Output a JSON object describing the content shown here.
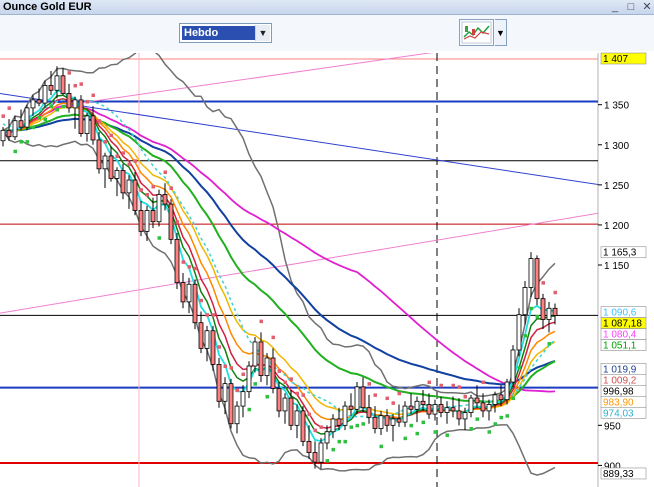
{
  "window": {
    "title": "Ounce Gold EUR"
  },
  "toolbar": {
    "period": "Hebdo"
  },
  "chart_data": {
    "type": "candlestick",
    "ylim": [
      890,
      1415
    ],
    "y_ticks": [
      "1 350",
      "1 300",
      "1 250",
      "1 200",
      "1 150",
      "950",
      "900"
    ],
    "price_tags": [
      {
        "label": "1 407",
        "value": 1407,
        "bg": "#ffff00",
        "fg": "#000000"
      },
      {
        "label": "1 165,3",
        "value": 1165.3,
        "bg": "#ffffff",
        "fg": "#000000"
      },
      {
        "label": "1 090,6",
        "value": 1090.6,
        "bg": "#ffffff",
        "fg": "#40c0ff"
      },
      {
        "label": "1 087,18",
        "value": 1087.18,
        "bg": "#ffff00",
        "fg": "#000000"
      },
      {
        "label": "1 080,4",
        "value": 1080.4,
        "bg": "#ffffff",
        "fg": "#ff40ff"
      },
      {
        "label": "1 051,1",
        "value": 1051.1,
        "bg": "#ffffff",
        "fg": "#00a000"
      },
      {
        "label": "1 019,9",
        "value": 1019.9,
        "bg": "#ffffff",
        "fg": "#204090"
      },
      {
        "label": "1 009,2",
        "value": 1009.2,
        "bg": "#ffffff",
        "fg": "#d05050"
      },
      {
        "label": "996,98",
        "value": 996.98,
        "bg": "#ffffff",
        "fg": "#000000"
      },
      {
        "label": "983,90",
        "value": 983.9,
        "bg": "#ffffff",
        "fg": "#ff9900"
      },
      {
        "label": "974,03",
        "value": 974.03,
        "bg": "#ffffff",
        "fg": "#30b0d0"
      },
      {
        "label": "889,33",
        "value": 889.33,
        "bg": "#ffffff",
        "fg": "#000000"
      }
    ],
    "horizontal_levels": [
      {
        "value": 1407,
        "color": "#ff8080"
      },
      {
        "value": 1354,
        "color": "#1a3cc0"
      },
      {
        "value": 1280,
        "color": "#000000"
      },
      {
        "value": 1201,
        "color": "#c00000"
      },
      {
        "value": 1087.18,
        "color": "#000000"
      },
      {
        "value": 997,
        "color": "#1a3cc0"
      },
      {
        "value": 903,
        "color": "#e00000"
      }
    ],
    "trend_lines": [
      {
        "x1": 0,
        "y1": 1364,
        "x2": 600,
        "y2": 1250,
        "color": "#3040d0"
      },
      {
        "x1": 0,
        "y1": 1090,
        "x2": 600,
        "y2": 1215,
        "color": "#f080d0"
      },
      {
        "x1": 40,
        "y1": 1345,
        "x2": 600,
        "y2": 1445,
        "color": "#f080d0"
      }
    ],
    "candles": [
      [
        1305,
        1322,
        1298,
        1318
      ],
      [
        1318,
        1332,
        1305,
        1310
      ],
      [
        1310,
        1336,
        1306,
        1330
      ],
      [
        1330,
        1344,
        1318,
        1322
      ],
      [
        1322,
        1350,
        1318,
        1346
      ],
      [
        1346,
        1362,
        1336,
        1356
      ],
      [
        1356,
        1370,
        1348,
        1352
      ],
      [
        1352,
        1380,
        1346,
        1374
      ],
      [
        1374,
        1392,
        1362,
        1368
      ],
      [
        1368,
        1398,
        1358,
        1386
      ],
      [
        1386,
        1396,
        1362,
        1364
      ],
      [
        1364,
        1376,
        1340,
        1346
      ],
      [
        1346,
        1360,
        1320,
        1356
      ],
      [
        1356,
        1362,
        1310,
        1314
      ],
      [
        1314,
        1340,
        1304,
        1336
      ],
      [
        1336,
        1348,
        1300,
        1306
      ],
      [
        1306,
        1316,
        1264,
        1270
      ],
      [
        1270,
        1290,
        1246,
        1286
      ],
      [
        1286,
        1298,
        1254,
        1258
      ],
      [
        1258,
        1272,
        1236,
        1268
      ],
      [
        1268,
        1276,
        1232,
        1240
      ],
      [
        1240,
        1262,
        1220,
        1256
      ],
      [
        1256,
        1266,
        1212,
        1218
      ],
      [
        1218,
        1230,
        1186,
        1192
      ],
      [
        1192,
        1224,
        1180,
        1218
      ],
      [
        1218,
        1234,
        1196,
        1204
      ],
      [
        1204,
        1244,
        1198,
        1238
      ],
      [
        1238,
        1252,
        1218,
        1226
      ],
      [
        1226,
        1232,
        1176,
        1182
      ],
      [
        1182,
        1190,
        1120,
        1128
      ],
      [
        1128,
        1140,
        1096,
        1104
      ],
      [
        1104,
        1134,
        1090,
        1126
      ],
      [
        1126,
        1132,
        1070,
        1078
      ],
      [
        1078,
        1092,
        1040,
        1046
      ],
      [
        1046,
        1074,
        1030,
        1068
      ],
      [
        1068,
        1074,
        1018,
        1026
      ],
      [
        1026,
        1034,
        972,
        980
      ],
      [
        980,
        1010,
        964,
        1002
      ],
      [
        1002,
        1008,
        946,
        952
      ],
      [
        952,
        980,
        940,
        974
      ],
      [
        974,
        1000,
        960,
        992
      ],
      [
        992,
        1030,
        984,
        1024
      ],
      [
        1024,
        1060,
        1016,
        1054
      ],
      [
        1054,
        1066,
        1004,
        1012
      ],
      [
        1012,
        1040,
        1000,
        1034
      ],
      [
        1034,
        1046,
        990,
        996
      ],
      [
        996,
        1004,
        960,
        968
      ],
      [
        968,
        990,
        952,
        984
      ],
      [
        984,
        994,
        944,
        950
      ],
      [
        950,
        976,
        934,
        968
      ],
      [
        968,
        974,
        924,
        930
      ],
      [
        930,
        950,
        908,
        916
      ],
      [
        916,
        930,
        896,
        904
      ],
      [
        904,
        934,
        896,
        928
      ],
      [
        928,
        950,
        920,
        942
      ],
      [
        942,
        964,
        934,
        958
      ],
      [
        958,
        972,
        944,
        950
      ],
      [
        950,
        980,
        944,
        974
      ],
      [
        974,
        990,
        962,
        970
      ],
      [
        970,
        1004,
        964,
        998
      ],
      [
        998,
        1010,
        966,
        972
      ],
      [
        972,
        988,
        952,
        960
      ],
      [
        960,
        974,
        940,
        946
      ],
      [
        946,
        968,
        938,
        962
      ],
      [
        962,
        970,
        942,
        950
      ],
      [
        950,
        964,
        930,
        958
      ],
      [
        958,
        976,
        948,
        954
      ],
      [
        954,
        980,
        948,
        974
      ],
      [
        974,
        990,
        964,
        970
      ],
      [
        970,
        986,
        954,
        980
      ],
      [
        980,
        994,
        968,
        976
      ],
      [
        976,
        990,
        958,
        964
      ],
      [
        964,
        982,
        956,
        976
      ],
      [
        976,
        986,
        960,
        966
      ],
      [
        966,
        980,
        952,
        972
      ],
      [
        972,
        986,
        960,
        968
      ],
      [
        968,
        984,
        950,
        958
      ],
      [
        958,
        972,
        944,
        966
      ],
      [
        966,
        988,
        960,
        984
      ],
      [
        984,
        1000,
        972,
        978
      ],
      [
        978,
        990,
        960,
        968
      ],
      [
        968,
        982,
        956,
        976
      ],
      [
        976,
        992,
        966,
        988
      ],
      [
        988,
        1000,
        974,
        982
      ],
      [
        982,
        1008,
        976,
        1004
      ],
      [
        1004,
        1050,
        998,
        1044
      ],
      [
        1044,
        1096,
        1036,
        1088
      ],
      [
        1088,
        1130,
        1076,
        1122
      ],
      [
        1122,
        1166,
        1110,
        1158
      ],
      [
        1158,
        1162,
        1100,
        1108
      ],
      [
        1108,
        1114,
        1070,
        1082
      ],
      [
        1082,
        1104,
        1066,
        1096
      ],
      [
        1096,
        1102,
        1076,
        1087
      ]
    ],
    "candle_x_start": 3,
    "candle_x_step": 6.0,
    "vertical_markers": [
      {
        "x": 139,
        "color": "#ffb0c0",
        "style": "solid"
      },
      {
        "x": 437,
        "color": "#000000",
        "style": "dashed"
      }
    ]
  }
}
